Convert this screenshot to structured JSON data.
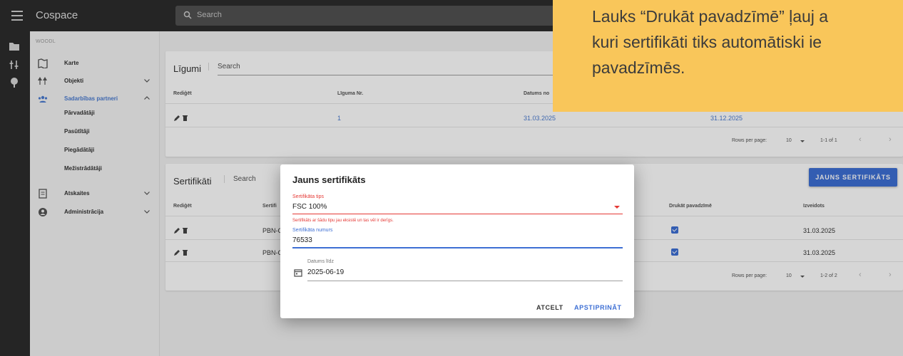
{
  "app": {
    "title": "Cospace",
    "search_placeholder": "Search"
  },
  "sidebar": {
    "org": "WOODL",
    "items": [
      {
        "label": "Karte",
        "icon": "map-icon"
      },
      {
        "label": "Objekti",
        "icon": "forest-icon"
      },
      {
        "label": "Sadarbības partneri",
        "icon": "people-icon"
      },
      {
        "label": "Atskaites",
        "icon": "report-icon"
      },
      {
        "label": "Administrācija",
        "icon": "account-icon"
      }
    ],
    "subitems": [
      "Pārvadātāji",
      "Pasūtītāji",
      "Piegādātāji",
      "Mežistrādātāji"
    ]
  },
  "contracts": {
    "title": "Līgumi",
    "search_placeholder": "Search",
    "columns": [
      "Rediģēt",
      "Līguma Nr.",
      "Datums no",
      ""
    ],
    "rows": [
      {
        "number": "1",
        "date_from": "31.03.2025",
        "date_to": "31.12.2025"
      }
    ],
    "rows_per_page_label": "Rows per page:",
    "rows_per_page": "10",
    "range": "1-1 of 1"
  },
  "certificates": {
    "title": "Sertifikāti",
    "search_placeholder": "Search",
    "columns": [
      "Rediģēt",
      "Sertifi",
      "Drukāt pavadzīmē",
      "Izveidots"
    ],
    "rows": [
      {
        "code": "PBN-C",
        "print": true,
        "created": "31.03.2025"
      },
      {
        "code": "PBN-C",
        "print": true,
        "created": "31.03.2025"
      }
    ],
    "rows_per_page_label": "Rows per page:",
    "rows_per_page": "10",
    "range": "1-2 of 2",
    "new_button": "JAUNS SERTIFIKĀTS"
  },
  "dialog": {
    "title": "Jauns sertifikāts",
    "type_label": "Sertifikāta tips",
    "type_value": "FSC 100%",
    "type_error": "Sertifikāts ar šādu tipu jau eksistē un tas vēl ir derīgs.",
    "number_label": "Sertifikāta numurs",
    "number_value": "76533",
    "date_label": "Datums līdz",
    "date_value": "2025-06-19",
    "cancel": "ATCELT",
    "confirm": "APSTIPRINĀT"
  },
  "callout": {
    "line1": "Lauks “Drukāt pavadzīmē” ļauj a",
    "line2": "kuri sertifikāti tiks automātiski ie",
    "line3": "pavadzīmēs."
  },
  "colors": {
    "accent": "#3d6fd4",
    "error": "#e53935",
    "callout": "#f9c65a",
    "dark": "#2d2d2d"
  }
}
